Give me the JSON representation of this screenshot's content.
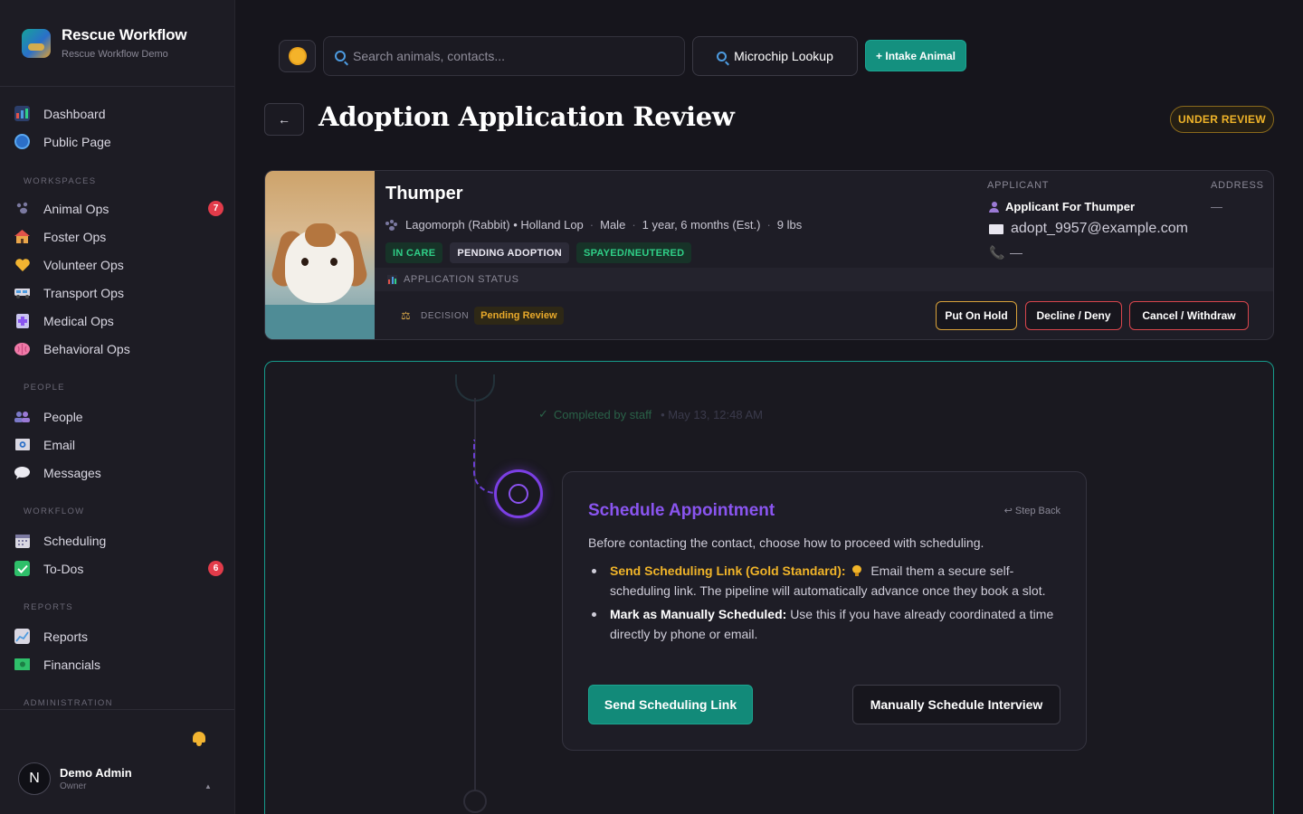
{
  "brand": {
    "title": "Rescue Workflow",
    "subtitle": "Rescue Workflow Demo"
  },
  "sidebar": {
    "top_items": [
      {
        "label": "Dashboard",
        "icon": "bar-chart-icon"
      },
      {
        "label": "Public Page",
        "icon": "globe-icon"
      }
    ],
    "sections": [
      {
        "title": "WORKSPACES",
        "items": [
          {
            "label": "Animal Ops",
            "icon": "paw-icon",
            "badge": "7"
          },
          {
            "label": "Foster Ops",
            "icon": "house-icon"
          },
          {
            "label": "Volunteer Ops",
            "icon": "heart-icon"
          },
          {
            "label": "Transport Ops",
            "icon": "van-icon"
          },
          {
            "label": "Medical Ops",
            "icon": "medical-icon"
          },
          {
            "label": "Behavioral Ops",
            "icon": "brain-icon"
          }
        ]
      },
      {
        "title": "PEOPLE",
        "items": [
          {
            "label": "People",
            "icon": "people-icon"
          },
          {
            "label": "Email",
            "icon": "email-icon"
          },
          {
            "label": "Messages",
            "icon": "chat-bubble-icon"
          }
        ]
      },
      {
        "title": "WORKFLOW",
        "items": [
          {
            "label": "Scheduling",
            "icon": "calendar-icon"
          },
          {
            "label": "To-Dos",
            "icon": "checkbox-icon",
            "badge": "6"
          }
        ]
      },
      {
        "title": "REPORTS",
        "items": [
          {
            "label": "Reports",
            "icon": "line-chart-icon"
          },
          {
            "label": "Financials",
            "icon": "money-icon"
          }
        ]
      },
      {
        "title": "ADMINISTRATION",
        "items": []
      }
    ],
    "user": {
      "initial": "N",
      "name": "Demo Admin",
      "role": "Owner"
    }
  },
  "topbar": {
    "search_placeholder": "Search animals, contacts...",
    "microchip_label": "Microchip Lookup",
    "intake_label": "+ Intake Animal"
  },
  "header": {
    "back_label": "←",
    "title": "Adoption Application Review",
    "status": "UNDER REVIEW"
  },
  "animal": {
    "name": "Thumper",
    "species": "Lagomorph (Rabbit) • Holland Lop",
    "sex": "Male",
    "age": "1 year, 6 months (Est.)",
    "weight": "9 lbs",
    "tags": [
      "IN CARE",
      "PENDING ADOPTION",
      "SPAYED/NEUTERED"
    ]
  },
  "applicant": {
    "label": "APPLICANT",
    "name": "Applicant For Thumper",
    "email": "adopt_9957@example.com",
    "phone": "—",
    "address_label": "ADDRESS",
    "address": "—"
  },
  "application_status": {
    "label": "APPLICATION STATUS",
    "decision_label": "DECISION",
    "decision_value": "Pending Review",
    "actions": [
      "Put On Hold",
      "Decline / Deny",
      "Cancel / Withdraw"
    ]
  },
  "workflow": {
    "completed_text": "Completed by staff",
    "completed_date": "• May 13, 12:48 AM",
    "step": {
      "title": "Schedule Appointment",
      "step_back": "↩ Step Back",
      "description": "Before contacting the contact, choose how to proceed with scheduling.",
      "option1_title": "Send Scheduling Link (Gold Standard):",
      "option1_text": "Email them a secure self-scheduling link. The pipeline will automatically advance once they book a slot.",
      "option2_title": "Mark as Manually Scheduled:",
      "option2_text": "Use this if you have already coordinated a time directly by phone or email.",
      "primary_button": "Send Scheduling Link",
      "secondary_button": "Manually Schedule Interview"
    }
  },
  "colors": {
    "accent_teal": "#14907f",
    "accent_purple": "#8a55f0",
    "warning_gold": "#f0b429",
    "danger_red": "#d9464d"
  }
}
